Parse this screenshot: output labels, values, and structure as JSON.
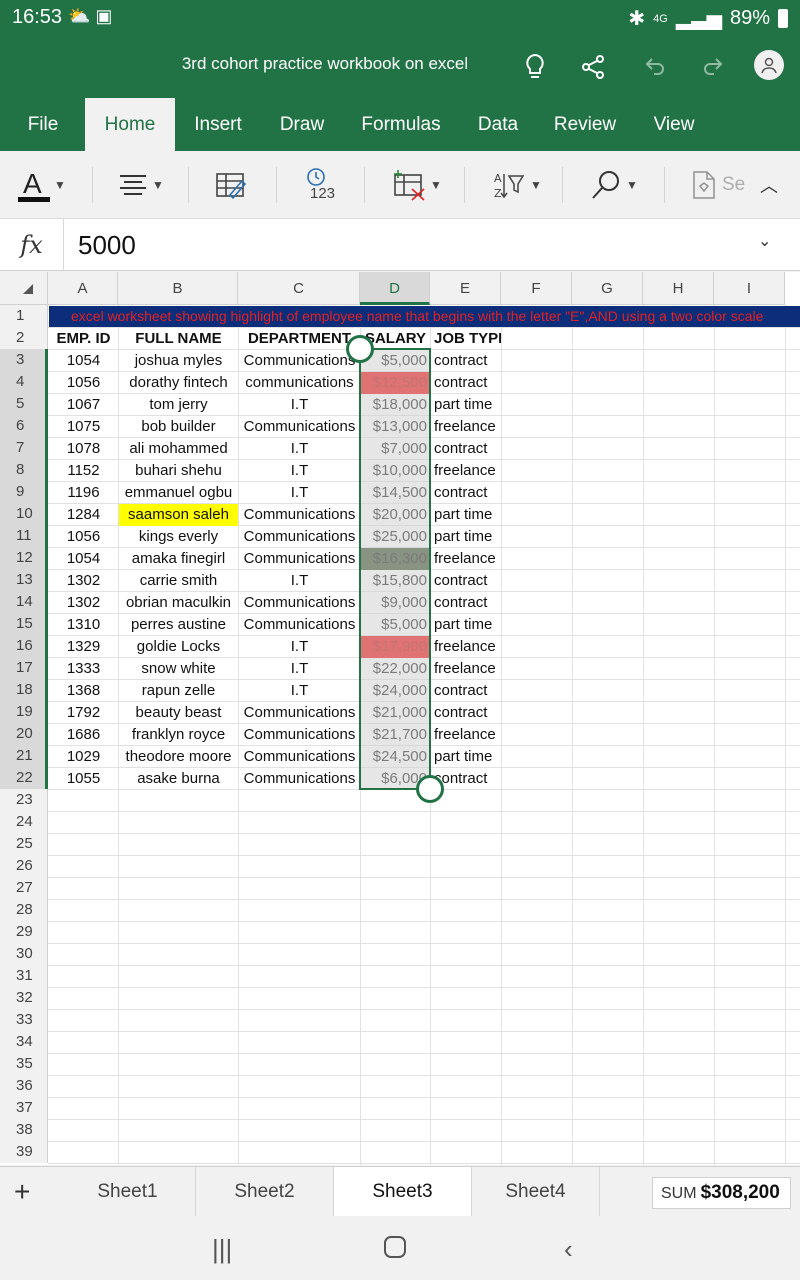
{
  "status": {
    "time": "16:53",
    "battery": "89%",
    "network": "4G"
  },
  "titlebar": {
    "title": "3rd cohort practice workbook on excel"
  },
  "tabs": [
    "File",
    "Home",
    "Insert",
    "Draw",
    "Formulas",
    "Data",
    "Review",
    "View"
  ],
  "active_tab": "Home",
  "ribbon": {
    "number_format_label": "123",
    "sensitivity_label": "Se"
  },
  "formula_bar": {
    "fx": "fx",
    "value": "5000"
  },
  "columns": [
    "A",
    "B",
    "C",
    "D",
    "E",
    "F",
    "G",
    "H",
    "I"
  ],
  "selected_column": "D",
  "row_numbers": [
    "1",
    "2",
    "3",
    "4",
    "5",
    "6",
    "7",
    "8",
    "9",
    "10",
    "11",
    "12",
    "13",
    "14",
    "15",
    "16",
    "17",
    "18",
    "19",
    "20",
    "21",
    "22",
    "23",
    "24",
    "25",
    "26",
    "27",
    "28",
    "29",
    "30",
    "31",
    "32",
    "33",
    "34",
    "35",
    "36",
    "37",
    "38",
    "39"
  ],
  "banner_text": "excel worksheet showing highlight of employee name that begins with the letter \"E\",AND using a two color scale",
  "headers": [
    "EMP. ID",
    "FULL NAME",
    "DEPARTMENT",
    "SALARY",
    "JOB TYPE"
  ],
  "rows": [
    {
      "id": "1054",
      "name": "joshua myles",
      "dept": "Communications",
      "salary": "$5,000",
      "job": "contract"
    },
    {
      "id": "1056",
      "name": "dorathy fintech",
      "dept": "communications",
      "salary": "$12,500",
      "job": "contract"
    },
    {
      "id": "1067",
      "name": "tom jerry",
      "dept": "I.T",
      "salary": "$18,000",
      "job": "part time"
    },
    {
      "id": "1075",
      "name": "bob builder",
      "dept": "Communications",
      "salary": "$13,000",
      "job": "freelance"
    },
    {
      "id": "1078",
      "name": "ali mohammed",
      "dept": "I.T",
      "salary": "$7,000",
      "job": "contract"
    },
    {
      "id": "1152",
      "name": "buhari shehu",
      "dept": "I.T",
      "salary": "$10,000",
      "job": "freelance"
    },
    {
      "id": "1196",
      "name": "emmanuel ogbu",
      "dept": "I.T",
      "salary": "$14,500",
      "job": "contract"
    },
    {
      "id": "1284",
      "name": "saamson saleh",
      "dept": "Communications",
      "salary": "$20,000",
      "job": "part time"
    },
    {
      "id": "1056",
      "name": "kings everly",
      "dept": "Communications",
      "salary": "$25,000",
      "job": "part time"
    },
    {
      "id": "1054",
      "name": "amaka finegirl",
      "dept": "Communications",
      "salary": "$16,300",
      "job": "freelance"
    },
    {
      "id": "1302",
      "name": "carrie smith",
      "dept": "I.T",
      "salary": "$15,800",
      "job": "contract"
    },
    {
      "id": "1302",
      "name": "obrian maculkin",
      "dept": "Communications",
      "salary": "$9,000",
      "job": "contract"
    },
    {
      "id": "1310",
      "name": "perres austine",
      "dept": "Communications",
      "salary": "$5,000",
      "job": "part time"
    },
    {
      "id": "1329",
      "name": "goldie Locks",
      "dept": "I.T",
      "salary": "$17,900",
      "job": "freelance"
    },
    {
      "id": "1333",
      "name": "snow white",
      "dept": "I.T",
      "salary": "$22,000",
      "job": "freelance"
    },
    {
      "id": "1368",
      "name": "rapun zelle",
      "dept": "I.T",
      "salary": "$24,000",
      "job": "contract"
    },
    {
      "id": "1792",
      "name": "beauty beast",
      "dept": "Communications",
      "salary": "$21,000",
      "job": "contract"
    },
    {
      "id": "1686",
      "name": "franklyn royce",
      "dept": "Communications",
      "salary": "$21,700",
      "job": "freelance"
    },
    {
      "id": "1029",
      "name": "theodore moore",
      "dept": "Communications",
      "salary": "$24,500",
      "job": "part time"
    },
    {
      "id": "1055",
      "name": "asake burna",
      "dept": "Communications",
      "salary": "$6,000",
      "job": "contract"
    }
  ],
  "highlights": {
    "name_yellow_row": 7,
    "salary_red_rows": [
      1,
      13
    ],
    "salary_green_rows": [
      9
    ],
    "colors": {
      "red": "#f00000",
      "dark_green": "#2f4a1f",
      "yellow": "#ffff00",
      "excel_green": "#217346"
    }
  },
  "sheets": [
    "Sheet1",
    "Sheet2",
    "Sheet3",
    "Sheet4"
  ],
  "active_sheet": "Sheet3",
  "status_sum": {
    "label": "SUM",
    "value": "$308,200"
  }
}
